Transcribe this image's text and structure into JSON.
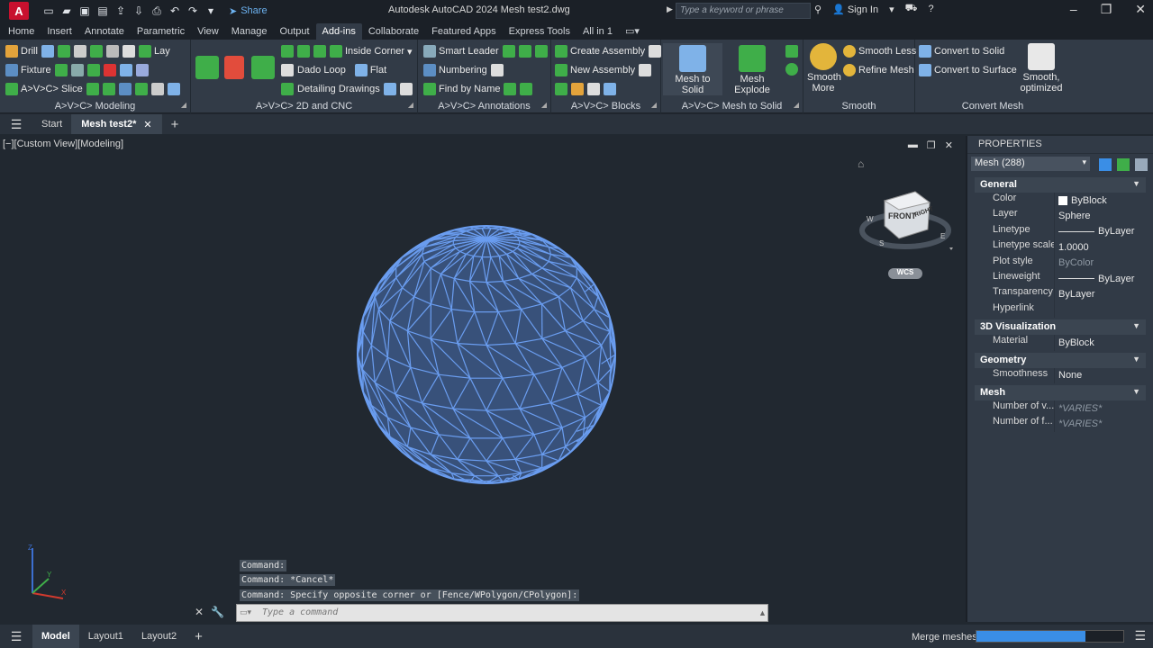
{
  "app": {
    "logo_letter": "A",
    "share_label": "Share",
    "title": "Autodesk AutoCAD 2024   Mesh test2.dwg",
    "search_placeholder": "Type a keyword or phrase",
    "sign_in": "Sign In"
  },
  "ribbon_tabs": [
    "Home",
    "Insert",
    "Annotate",
    "Parametric",
    "View",
    "Manage",
    "Output",
    "Add-ins",
    "Collaborate",
    "Featured Apps",
    "Express Tools",
    "All in 1"
  ],
  "active_tab": "Add-ins",
  "panels": {
    "modeling": {
      "title": "A>V>C> Modeling",
      "drill": "Drill",
      "lay": "Lay",
      "fixture": "Fixture",
      "slice": "A>V>C> Slice"
    },
    "cnc": {
      "title": "A>V>C> 2D and CNC",
      "inside_corner": "Inside Corner",
      "dado_loop": "Dado Loop",
      "flat": "Flat",
      "detailing": "Detailing Drawings"
    },
    "annotations": {
      "title": "A>V>C> Annotations",
      "smart_leader": "Smart Leader",
      "numbering": "Numbering",
      "find_by_name": "Find by Name"
    },
    "blocks": {
      "title": "A>V>C> Blocks",
      "create_assembly": "Create Assembly",
      "new_assembly": "New Assembly"
    },
    "mesh_to_solid": {
      "title": "A>V>C> Mesh to Solid",
      "mesh_to_solid": "Mesh to Solid",
      "mesh_explode": "Mesh Explode"
    },
    "smooth": {
      "title": "Smooth",
      "smooth_more_1": "Smooth",
      "smooth_more_2": "More",
      "smooth_less": "Smooth Less",
      "refine_mesh": "Refine Mesh"
    },
    "convert": {
      "title": "Convert Mesh",
      "convert_solid": "Convert to Solid",
      "convert_surface": "Convert to Surface",
      "smooth_opt_1": "Smooth,",
      "smooth_opt_2": "optimized"
    }
  },
  "doc_tabs": {
    "start": "Start",
    "active": "Mesh test2*"
  },
  "viewport": {
    "label": "[−][Custom View][Modeling]"
  },
  "command_history": [
    "Command:",
    "Command: *Cancel*",
    "Command: Specify opposite corner or [Fence/WPolygon/CPolygon]:"
  ],
  "command_placeholder": "Type a command",
  "viewcube": {
    "front": "FRONT",
    "right": "RIGHT",
    "wcs": "WCS"
  },
  "properties": {
    "header": "PROPERTIES",
    "selection": "Mesh (288)",
    "categories": {
      "general": "General",
      "visualization": "3D Visualization",
      "geometry": "Geometry",
      "mesh": "Mesh"
    },
    "general": [
      {
        "name": "Color",
        "value": "ByBlock"
      },
      {
        "name": "Layer",
        "value": "Sphere"
      },
      {
        "name": "Linetype",
        "value": "ByLayer"
      },
      {
        "name": "Linetype scale",
        "value": "1.0000"
      },
      {
        "name": "Plot style",
        "value": "ByColor"
      },
      {
        "name": "Lineweight",
        "value": "ByLayer"
      },
      {
        "name": "Transparency",
        "value": "ByLayer"
      },
      {
        "name": "Hyperlink",
        "value": ""
      }
    ],
    "visualization": [
      {
        "name": "Material",
        "value": "ByBlock"
      }
    ],
    "geometry": [
      {
        "name": "Smoothness",
        "value": "None"
      }
    ],
    "mesh": [
      {
        "name": "Number of v...",
        "value": "*VARIES*"
      },
      {
        "name": "Number of f...",
        "value": "*VARIES*"
      }
    ]
  },
  "status": {
    "model": "Model",
    "layout1": "Layout1",
    "layout2": "Layout2",
    "merge": "Merge meshes",
    "progress": 0.74
  },
  "colors": {
    "mesh": "#6a9df0",
    "accent": "#3a8ee6",
    "bg": "#212830"
  }
}
